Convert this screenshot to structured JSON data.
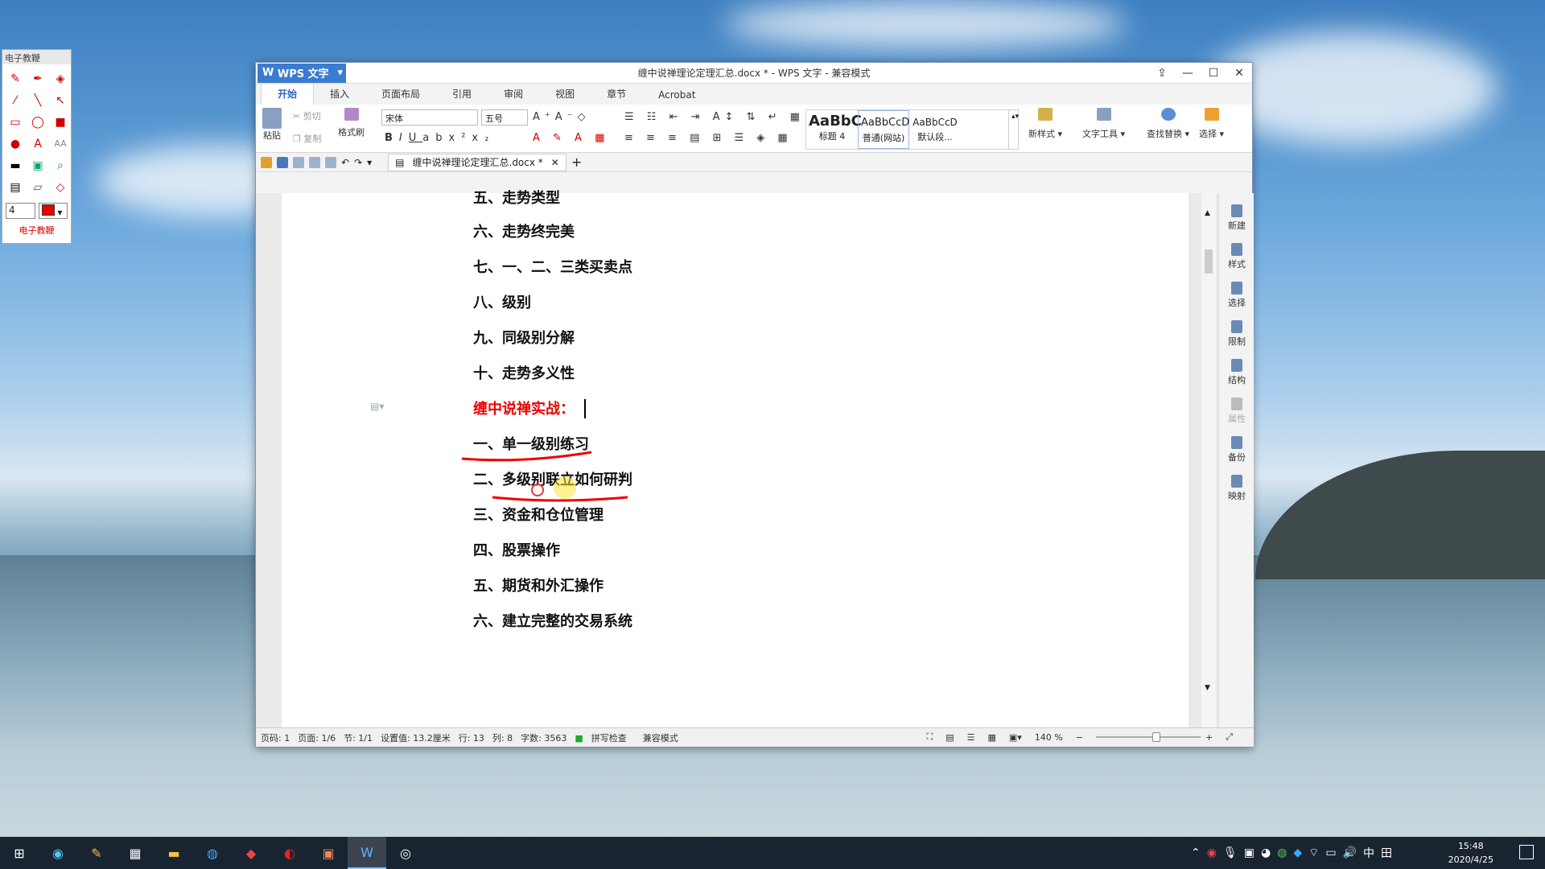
{
  "tool": {
    "title": "电子教鞭",
    "size": "4",
    "footer": "电子教鞭"
  },
  "window": {
    "app_button": "WPS 文字",
    "title": "缠中说禅理论定理汇总.docx * - WPS 文字 - 兼容模式",
    "tabs": [
      "开始",
      "插入",
      "页面布局",
      "引用",
      "审阅",
      "视图",
      "章节",
      "Acrobat"
    ],
    "ribbon": {
      "paste": "粘贴",
      "cut": "剪切",
      "copy": "复制",
      "format_painter": "格式刷",
      "font": "宋体",
      "size": "五号",
      "styles": [
        {
          "sample": "AaBbC",
          "name": "标题 4"
        },
        {
          "sample": "AaBbCcD",
          "name": "普通(网站)"
        },
        {
          "sample": "AaBbCcD",
          "name": "默认段..."
        }
      ],
      "new_style": "新样式",
      "text_tools": "文字工具",
      "find_replace": "查找替换",
      "select": "选择"
    },
    "doc_tab": "缠中说禅理论定理汇总.docx *",
    "document_lines": [
      {
        "text": "五、走势类型",
        "red": false
      },
      {
        "text": "六、走势终完美",
        "red": false
      },
      {
        "text": "七、一、二、三类买卖点",
        "red": false
      },
      {
        "text": "八、级别",
        "red": false
      },
      {
        "text": "九、同级别分解",
        "red": false
      },
      {
        "text": "十、走势多义性",
        "red": false
      },
      {
        "text": "缠中说禅实战：",
        "red": true
      },
      {
        "text": "一、单一级别练习",
        "red": false
      },
      {
        "text": "二、多级别联立如何研判",
        "red": false
      },
      {
        "text": "三、资金和仓位管理",
        "red": false
      },
      {
        "text": "四、股票操作",
        "red": false
      },
      {
        "text": "五、期货和外汇操作",
        "red": false
      },
      {
        "text": "六、建立完整的交易系统",
        "red": false
      }
    ],
    "side_panel": [
      "新建",
      "样式",
      "选择",
      "限制",
      "结构",
      "属性",
      "备份",
      "映射"
    ],
    "status": {
      "page_num": "页码: 1",
      "page": "页面: 1/6",
      "section": "节: 1/1",
      "setting": "设置值: 13.2厘米",
      "row": "行: 13",
      "col": "列: 8",
      "words": "字数: 3563",
      "spell": "拼写检查",
      "compat": "兼容模式",
      "zoom": "140 %"
    }
  },
  "taskbar": {
    "ime": "中",
    "time": "15:48",
    "date": "2020/4/25"
  }
}
